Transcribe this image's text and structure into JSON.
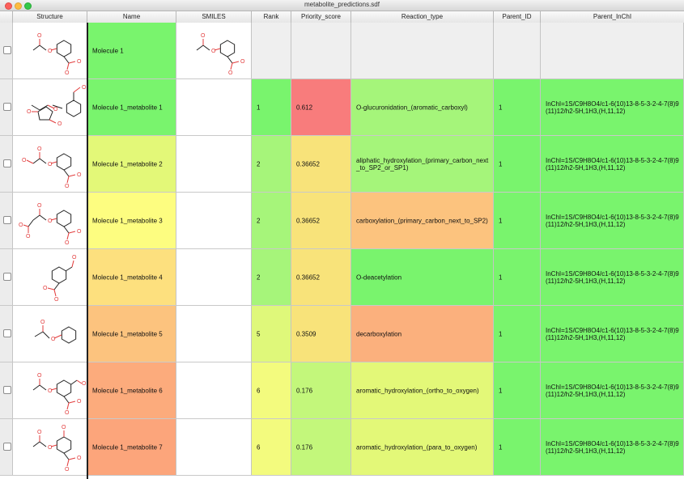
{
  "window": {
    "title": "metabolite_predictions.sdf"
  },
  "columns": [
    "Structure",
    "Name",
    "SMILES",
    "Rank",
    "Priority_score",
    "Reaction_type",
    "Parent_ID",
    "Parent_InChI"
  ],
  "rows": [
    {
      "name": "Molecule 1",
      "rank": "",
      "priority_score": "",
      "reaction_type": "",
      "parent_id": "",
      "parent_inchi": "",
      "colors": {
        "name": "#79f46d",
        "rank": "#efefef",
        "score": "#efefef",
        "reaction": "#efefef",
        "parent_id": "#efefef",
        "inchi": "#efefef"
      }
    },
    {
      "name": "Molecule 1_metabolite 1",
      "rank": "1",
      "priority_score": "0.612",
      "reaction_type": "O-glucuronidation_(aromatic_carboxyl)",
      "parent_id": "1",
      "parent_inchi": "InChI=1S/C9H8O4/c1-6(10)13-8-5-3-2-4-7(8)9(11)12/h2-5H,1H3,(H,11,12)",
      "colors": {
        "name": "#79f46d",
        "rank": "#79f46d",
        "score": "#f87c7c",
        "reaction": "#a5f57a",
        "parent_id": "#79f46d",
        "inchi": "#79f46d"
      }
    },
    {
      "name": "Molecule 1_metabolite 2",
      "rank": "2",
      "priority_score": "0.36652",
      "reaction_type": "aliphatic_hydroxylation_(primary_carbon_next_to_SP2_or_SP1)",
      "parent_id": "1",
      "parent_inchi": "InChI=1S/C9H8O4/c1-6(10)13-8-5-3-2-4-7(8)9(11)12/h2-5H,1H3,(H,11,12)",
      "colors": {
        "name": "#e3f878",
        "rank": "#a6f57a",
        "score": "#f8e37a",
        "reaction": "#a5f57a",
        "parent_id": "#79f46d",
        "inchi": "#79f46d"
      }
    },
    {
      "name": "Molecule 1_metabolite 3",
      "rank": "2",
      "priority_score": "0.36652",
      "reaction_type": "carboxylation_(primary_carbon_next_to_SP2)",
      "parent_id": "1",
      "parent_inchi": "InChI=1S/C9H8O4/c1-6(10)13-8-5-3-2-4-7(8)9(11)12/h2-5H,1H3,(H,11,12)",
      "colors": {
        "name": "#fdfd80",
        "rank": "#a6f57a",
        "score": "#f8e37a",
        "reaction": "#fcc37e",
        "parent_id": "#79f46d",
        "inchi": "#79f46d"
      }
    },
    {
      "name": "Molecule 1_metabolite 4",
      "rank": "2",
      "priority_score": "0.36652",
      "reaction_type": "O-deacetylation",
      "parent_id": "1",
      "parent_inchi": "InChI=1S/C9H8O4/c1-6(10)13-8-5-3-2-4-7(8)9(11)12/h2-5H,1H3,(H,11,12)",
      "colors": {
        "name": "#fde07e",
        "rank": "#a6f57a",
        "score": "#f8e37a",
        "reaction": "#79f46d",
        "parent_id": "#79f46d",
        "inchi": "#79f46d"
      }
    },
    {
      "name": "Molecule 1_metabolite 5",
      "rank": "5",
      "priority_score": "0.3509",
      "reaction_type": "decarboxylation",
      "parent_id": "1",
      "parent_inchi": "InChI=1S/C9H8O4/c1-6(10)13-8-5-3-2-4-7(8)9(11)12/h2-5H,1H3,(H,11,12)",
      "colors": {
        "name": "#fcc37e",
        "rank": "#dff87a",
        "score": "#f8e37a",
        "reaction": "#fbb07d",
        "parent_id": "#79f46d",
        "inchi": "#79f46d"
      }
    },
    {
      "name": "Molecule 1_metabolite 6",
      "rank": "6",
      "priority_score": "0.176",
      "reaction_type": "aromatic_hydroxylation_(ortho_to_oxygen)",
      "parent_id": "1",
      "parent_inchi": "InChI=1S/C9H8O4/c1-6(10)13-8-5-3-2-4-7(8)9(11)12/h2-5H,1H3,(H,11,12)",
      "colors": {
        "name": "#fcab7c",
        "rank": "#f3fb7e",
        "score": "#c3f77b",
        "reaction": "#e3f878",
        "parent_id": "#79f46d",
        "inchi": "#79f46d"
      }
    },
    {
      "name": "Molecule 1_metabolite 7",
      "rank": "6",
      "priority_score": "0.176",
      "reaction_type": "aromatic_hydroxylation_(para_to_oxygen)",
      "parent_id": "1",
      "parent_inchi": "InChI=1S/C9H8O4/c1-6(10)13-8-5-3-2-4-7(8)9(11)12/h2-5H,1H3,(H,11,12)",
      "colors": {
        "name": "#fca57b",
        "rank": "#f3fb7e",
        "score": "#c3f77b",
        "reaction": "#e3f878",
        "parent_id": "#79f46d",
        "inchi": "#79f46d"
      }
    }
  ],
  "structure_icons": [
    "aspirin-structure-icon",
    "glucuronide-structure-icon",
    "hydroxy-aspirin-structure-icon",
    "carboxy-aspirin-structure-icon",
    "salicylic-acid-structure-icon",
    "phenyl-acetate-structure-icon",
    "ortho-hydroxy-aspirin-structure-icon",
    "para-hydroxy-aspirin-structure-icon"
  ]
}
